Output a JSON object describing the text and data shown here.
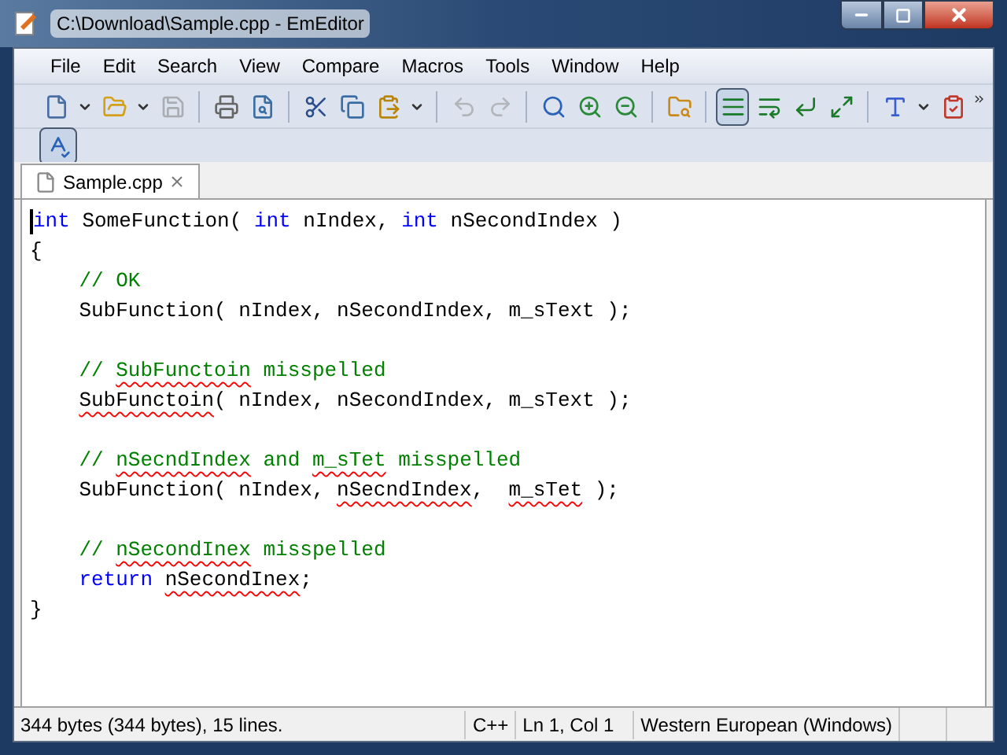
{
  "window": {
    "title": "C:\\Download\\Sample.cpp - EmEditor"
  },
  "menu": [
    "File",
    "Edit",
    "Search",
    "View",
    "Compare",
    "Macros",
    "Tools",
    "Window",
    "Help"
  ],
  "toolbar": [
    {
      "kind": "new",
      "pressed": false,
      "disabled": false
    },
    {
      "kind": "dropdown",
      "pressed": false,
      "disabled": false
    },
    {
      "kind": "open",
      "pressed": false,
      "disabled": false
    },
    {
      "kind": "dropdown",
      "pressed": false,
      "disabled": false
    },
    {
      "kind": "save",
      "pressed": false,
      "disabled": true
    },
    {
      "kind": "sep"
    },
    {
      "kind": "print",
      "pressed": false,
      "disabled": false
    },
    {
      "kind": "preview",
      "pressed": false,
      "disabled": false
    },
    {
      "kind": "sep"
    },
    {
      "kind": "cut",
      "pressed": false,
      "disabled": false
    },
    {
      "kind": "copy",
      "pressed": false,
      "disabled": false
    },
    {
      "kind": "paste",
      "pressed": false,
      "disabled": false
    },
    {
      "kind": "dropdown",
      "pressed": false,
      "disabled": false
    },
    {
      "kind": "sep"
    },
    {
      "kind": "undo",
      "pressed": false,
      "disabled": true
    },
    {
      "kind": "redo",
      "pressed": false,
      "disabled": true
    },
    {
      "kind": "sep"
    },
    {
      "kind": "find",
      "pressed": false,
      "disabled": false
    },
    {
      "kind": "find-next",
      "pressed": false,
      "disabled": false
    },
    {
      "kind": "find-prev",
      "pressed": false,
      "disabled": false
    },
    {
      "kind": "sep"
    },
    {
      "kind": "find-files",
      "pressed": false,
      "disabled": false
    },
    {
      "kind": "sep"
    },
    {
      "kind": "wrap-none",
      "pressed": true,
      "disabled": false
    },
    {
      "kind": "wrap-chars",
      "pressed": false,
      "disabled": false
    },
    {
      "kind": "wrap-window",
      "pressed": false,
      "disabled": false
    },
    {
      "kind": "wrap-page",
      "pressed": false,
      "disabled": false
    },
    {
      "kind": "sep"
    },
    {
      "kind": "font",
      "pressed": false,
      "disabled": false
    },
    {
      "kind": "dropdown",
      "pressed": false,
      "disabled": false
    },
    {
      "kind": "properties",
      "pressed": false,
      "disabled": false
    }
  ],
  "toolbar2": [
    {
      "kind": "spell",
      "pressed": true,
      "disabled": false
    }
  ],
  "tabs": [
    {
      "label": "Sample.cpp",
      "selected": true
    }
  ],
  "editor": {
    "lines": [
      {
        "kind": "code",
        "indented": false,
        "segments": [
          {
            "text": "int",
            "kind": "keyword"
          },
          {
            "text": " SomeFunction( ",
            "kind": "plain"
          },
          {
            "text": "int",
            "kind": "keyword"
          },
          {
            "text": " nIndex, ",
            "kind": "plain"
          },
          {
            "text": "int",
            "kind": "keyword"
          },
          {
            "text": " nSecondIndex )",
            "kind": "plain"
          }
        ]
      },
      {
        "kind": "code",
        "indented": false,
        "segments": [
          {
            "text": "{",
            "kind": "plain"
          }
        ]
      },
      {
        "kind": "code",
        "indented": true,
        "segments": [
          {
            "text": "// OK",
            "kind": "comment"
          }
        ]
      },
      {
        "kind": "code",
        "indented": true,
        "segments": [
          {
            "text": "SubFunction( nIndex, nSecondIndex, m_sText );",
            "kind": "plain"
          }
        ]
      },
      {
        "kind": "blank"
      },
      {
        "kind": "code",
        "indented": true,
        "segments": [
          {
            "text": "// ",
            "kind": "comment",
            "misspelled": false
          },
          {
            "text": "SubFunctoin",
            "kind": "comment",
            "misspelled": true
          },
          {
            "text": " misspelled",
            "kind": "comment",
            "misspelled": false
          }
        ]
      },
      {
        "kind": "code",
        "indented": true,
        "segments": [
          {
            "text": "SubFunctoin",
            "kind": "plain",
            "misspelled": true
          },
          {
            "text": "( nIndex, nSecondIndex, m_sText );",
            "kind": "plain",
            "misspelled": false
          }
        ]
      },
      {
        "kind": "blank"
      },
      {
        "kind": "code",
        "indented": true,
        "segments": [
          {
            "text": "// ",
            "kind": "comment",
            "misspelled": false
          },
          {
            "text": "nSecndIndex",
            "kind": "comment",
            "misspelled": true
          },
          {
            "text": " and ",
            "kind": "comment",
            "misspelled": false
          },
          {
            "text": "m_sTet",
            "kind": "comment",
            "misspelled": true
          },
          {
            "text": " misspelled",
            "kind": "comment",
            "misspelled": false
          }
        ]
      },
      {
        "kind": "code",
        "indented": true,
        "segments": [
          {
            "text": "SubFunction( nIndex, ",
            "kind": "plain",
            "misspelled": false
          },
          {
            "text": "nSecndIndex",
            "kind": "plain",
            "misspelled": true
          },
          {
            "text": ",  ",
            "kind": "plain",
            "misspelled": false
          },
          {
            "text": "m_sTet",
            "kind": "plain",
            "misspelled": true
          },
          {
            "text": " );",
            "kind": "plain",
            "misspelled": false
          }
        ]
      },
      {
        "kind": "blank"
      },
      {
        "kind": "code",
        "indented": true,
        "segments": [
          {
            "text": "// ",
            "kind": "comment",
            "misspelled": false
          },
          {
            "text": "nSecondInex",
            "kind": "comment",
            "misspelled": true
          },
          {
            "text": " misspelled",
            "kind": "comment",
            "misspelled": false
          }
        ]
      },
      {
        "kind": "code",
        "indented": true,
        "segments": [
          {
            "text": "return ",
            "kind": "keyword",
            "misspelled": false
          },
          {
            "text": "nSecondInex",
            "kind": "plain",
            "misspelled": true
          },
          {
            "text": ";",
            "kind": "plain",
            "misspelled": false
          }
        ]
      },
      {
        "kind": "code",
        "indented": false,
        "segments": [
          {
            "text": "}",
            "kind": "plain"
          }
        ]
      }
    ]
  },
  "status_bar": [
    "344 bytes (344 bytes), 15 lines.",
    "C++",
    "Ln 1, Col 1",
    "Western European (Windows)"
  ]
}
